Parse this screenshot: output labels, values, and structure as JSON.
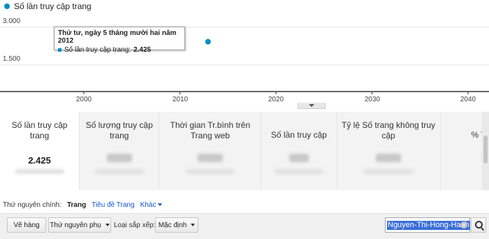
{
  "chart": {
    "legend_label": "Số lần truy cập trang",
    "series_color": "#058dc7",
    "y_ticks": [
      "3.000",
      "1.500"
    ],
    "x_ticks": [
      "2000",
      "2010",
      "2020",
      "2030",
      "2040"
    ],
    "tooltip": {
      "date": "Thứ tư, ngày 5 tháng mười hai năm 2012",
      "series_label": "Số lần truy cập trang:",
      "value": "2.425"
    }
  },
  "chart_data": {
    "type": "scatter",
    "series": [
      {
        "name": "Số lần truy cập trang",
        "points": [
          {
            "x": 2012.93,
            "y": 2425
          }
        ]
      }
    ],
    "x_ticks": [
      2000,
      2010,
      2020,
      2030,
      2040
    ],
    "y_ticks": [
      1500,
      3000
    ],
    "grid": true,
    "legend": "top-left"
  },
  "metrics": [
    {
      "label": "Số lần truy cập trang",
      "value": "2.425"
    },
    {
      "label": "Số lượng truy cập trang",
      "value": ""
    },
    {
      "label": "Thời gian Tr.bình trên Trang web",
      "value": ""
    },
    {
      "label": "Số lần truy cập",
      "value": ""
    },
    {
      "label": "Tỷ lệ Số trang không truy cập",
      "value": ""
    },
    {
      "label": "% T",
      "value": ""
    }
  ],
  "dimension_bar": {
    "label": "Thứ nguyên chính:",
    "active": "Trang",
    "option1": "Tiêu đề Trang",
    "option2": "Khác"
  },
  "toolbar": {
    "plot_button": "Vẽ hàng",
    "secondary_dimension": "Thứ nguyên phụ",
    "sort_label": "Loại sắp xếp:",
    "sort_value": "Mặc định",
    "search_value": "Nguyen-Thi-Hong-Hanh"
  }
}
